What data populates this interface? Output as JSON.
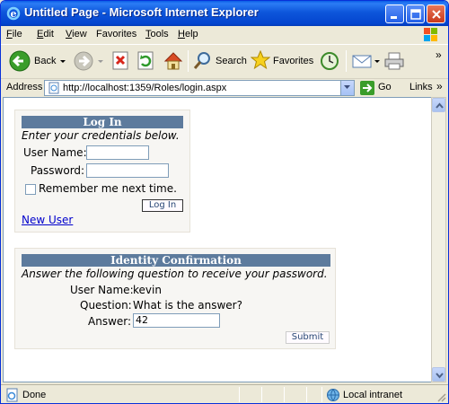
{
  "window": {
    "title": "Untitled Page - Microsoft Internet Explorer"
  },
  "menu": {
    "items": [
      {
        "label": "File",
        "accel": "F",
        "rest": "ile"
      },
      {
        "label": "Edit",
        "accel": "E",
        "rest": "dit"
      },
      {
        "label": "View",
        "accel": "V",
        "rest": "iew"
      },
      {
        "label": "Favorites",
        "accel": "F",
        "rest": "avorites",
        "pre": "",
        "underline_index": 0
      },
      {
        "label": "Tools",
        "accel": "T",
        "rest": "ools"
      },
      {
        "label": "Help",
        "accel": "H",
        "rest": "elp"
      }
    ]
  },
  "toolbar": {
    "back_label": "Back",
    "search_label": "Search",
    "favorites_label": "Favorites",
    "overflow": "»"
  },
  "address": {
    "label": "Address",
    "url": "http://localhost:1359/Roles/login.aspx",
    "go_label": "Go",
    "links_label": "Links",
    "overflow": "»"
  },
  "login": {
    "header": "Log In",
    "instructions": "Enter your credentials below.",
    "username_label": "User Name:",
    "username_value": "",
    "password_label": "Password:",
    "password_value": "",
    "remember_label": "Remember me next time.",
    "remember_checked": false,
    "login_button": "Log In",
    "new_user_link": "New User"
  },
  "identity": {
    "header": "Identity Confirmation",
    "instructions": "Answer the following question to receive your password.",
    "username_label": "User Name:",
    "username_value": "kevin",
    "question_label": "Question:",
    "question_value": "What is the answer?",
    "answer_label": "Answer:",
    "answer_value": "42",
    "submit_button": "Submit"
  },
  "status": {
    "text": "Done",
    "zone": "Local intranet"
  },
  "colors": {
    "header_bg": "#5d7b9d",
    "box_bg": "#f7f6f3",
    "link": "#0000cc",
    "titlebar": "#0d56db"
  }
}
